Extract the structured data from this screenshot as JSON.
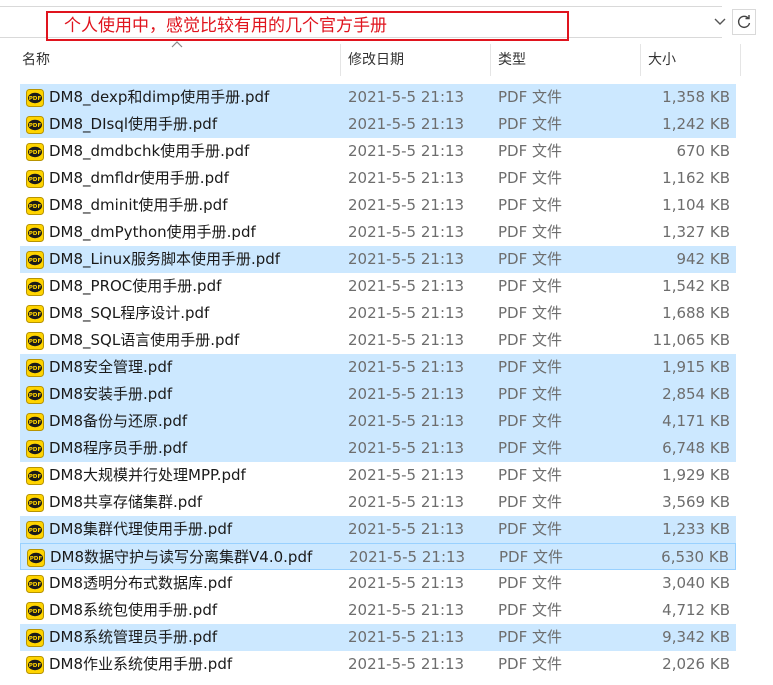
{
  "address": {
    "annotation": "个人使用中，感觉比较有用的几个官方手册"
  },
  "columns": {
    "name": "名称",
    "date": "修改日期",
    "type": "类型",
    "size": "大小"
  },
  "colors": {
    "selected_row": "#cce8ff",
    "annotation": "#e0141e",
    "pdf_icon_bg": "#ffd400"
  },
  "files": [
    {
      "name": "DM8_dexp和dimp使用手册.pdf",
      "date": "2021-5-5 21:13",
      "type": "PDF 文件",
      "size": "1,358 KB",
      "selected": true
    },
    {
      "name": "DM8_DIsql使用手册.pdf",
      "date": "2021-5-5 21:13",
      "type": "PDF 文件",
      "size": "1,242 KB",
      "selected": true
    },
    {
      "name": "DM8_dmdbchk使用手册.pdf",
      "date": "2021-5-5 21:13",
      "type": "PDF 文件",
      "size": "670 KB",
      "selected": false
    },
    {
      "name": "DM8_dmfldr使用手册.pdf",
      "date": "2021-5-5 21:13",
      "type": "PDF 文件",
      "size": "1,162 KB",
      "selected": false
    },
    {
      "name": "DM8_dminit使用手册.pdf",
      "date": "2021-5-5 21:13",
      "type": "PDF 文件",
      "size": "1,104 KB",
      "selected": false
    },
    {
      "name": "DM8_dmPython使用手册.pdf",
      "date": "2021-5-5 21:13",
      "type": "PDF 文件",
      "size": "1,327 KB",
      "selected": false
    },
    {
      "name": "DM8_Linux服务脚本使用手册.pdf",
      "date": "2021-5-5 21:13",
      "type": "PDF 文件",
      "size": "942 KB",
      "selected": true
    },
    {
      "name": "DM8_PROC使用手册.pdf",
      "date": "2021-5-5 21:13",
      "type": "PDF 文件",
      "size": "1,542 KB",
      "selected": false
    },
    {
      "name": "DM8_SQL程序设计.pdf",
      "date": "2021-5-5 21:13",
      "type": "PDF 文件",
      "size": "1,688 KB",
      "selected": false
    },
    {
      "name": "DM8_SQL语言使用手册.pdf",
      "date": "2021-5-5 21:13",
      "type": "PDF 文件",
      "size": "11,065 KB",
      "selected": false
    },
    {
      "name": "DM8安全管理.pdf",
      "date": "2021-5-5 21:13",
      "type": "PDF 文件",
      "size": "1,915 KB",
      "selected": true
    },
    {
      "name": "DM8安装手册.pdf",
      "date": "2021-5-5 21:13",
      "type": "PDF 文件",
      "size": "2,854 KB",
      "selected": true
    },
    {
      "name": "DM8备份与还原.pdf",
      "date": "2021-5-5 21:13",
      "type": "PDF 文件",
      "size": "4,171 KB",
      "selected": true
    },
    {
      "name": "DM8程序员手册.pdf",
      "date": "2021-5-5 21:13",
      "type": "PDF 文件",
      "size": "6,748 KB",
      "selected": true
    },
    {
      "name": "DM8大规模并行处理MPP.pdf",
      "date": "2021-5-5 21:13",
      "type": "PDF 文件",
      "size": "1,929 KB",
      "selected": false
    },
    {
      "name": "DM8共享存储集群.pdf",
      "date": "2021-5-5 21:13",
      "type": "PDF 文件",
      "size": "3,569 KB",
      "selected": false
    },
    {
      "name": "DM8集群代理使用手册.pdf",
      "date": "2021-5-5 21:13",
      "type": "PDF 文件",
      "size": "1,233 KB",
      "selected": true
    },
    {
      "name": "DM8数据守护与读写分离集群V4.0.pdf",
      "date": "2021-5-5 21:13",
      "type": "PDF 文件",
      "size": "6,530 KB",
      "selected": true,
      "focused": true
    },
    {
      "name": "DM8透明分布式数据库.pdf",
      "date": "2021-5-5 21:13",
      "type": "PDF 文件",
      "size": "3,040 KB",
      "selected": false
    },
    {
      "name": "DM8系统包使用手册.pdf",
      "date": "2021-5-5 21:13",
      "type": "PDF 文件",
      "size": "4,712 KB",
      "selected": false
    },
    {
      "name": "DM8系统管理员手册.pdf",
      "date": "2021-5-5 21:13",
      "type": "PDF 文件",
      "size": "9,342 KB",
      "selected": true
    },
    {
      "name": "DM8作业系统使用手册.pdf",
      "date": "2021-5-5 21:13",
      "type": "PDF 文件",
      "size": "2,026 KB",
      "selected": false
    }
  ]
}
